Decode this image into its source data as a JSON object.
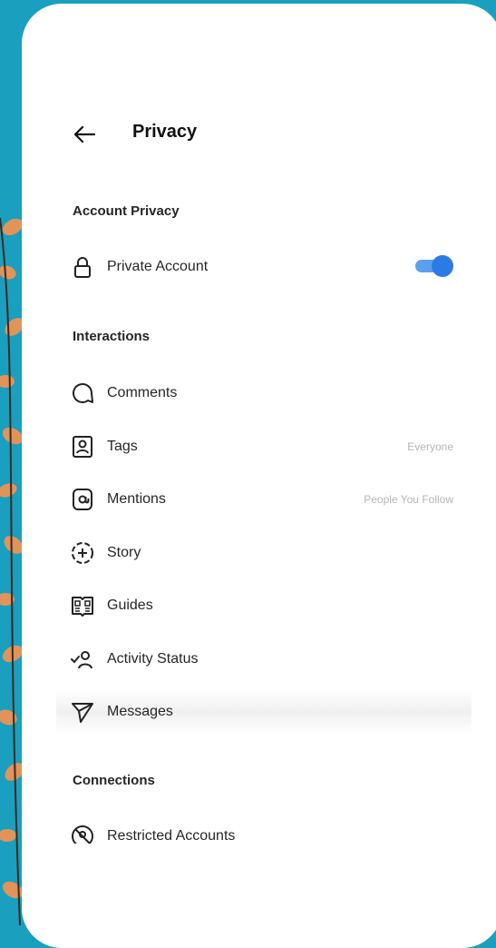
{
  "header": {
    "title": "Privacy"
  },
  "sections": {
    "account_privacy": "Account Privacy",
    "interactions": "Interactions",
    "connections": "Connections"
  },
  "account": {
    "private_account": {
      "label": "Private Account",
      "toggle_on": true,
      "accent": "#2a7be3"
    }
  },
  "interactions": {
    "comments": {
      "label": "Comments",
      "icon": "comment-icon"
    },
    "tags": {
      "label": "Tags",
      "value": "Everyone",
      "icon": "tag-person-icon"
    },
    "mentions": {
      "label": "Mentions",
      "value": "People You Follow",
      "icon": "at-icon"
    },
    "story": {
      "label": "Story",
      "icon": "story-add-icon"
    },
    "guides": {
      "label": "Guides",
      "icon": "guides-icon"
    },
    "activity_status": {
      "label": "Activity Status",
      "icon": "activity-status-icon"
    },
    "messages": {
      "label": "Messages",
      "icon": "send-icon"
    }
  },
  "connections": {
    "restricted_accounts": {
      "label": "Restricted Accounts",
      "icon": "restricted-icon"
    }
  }
}
